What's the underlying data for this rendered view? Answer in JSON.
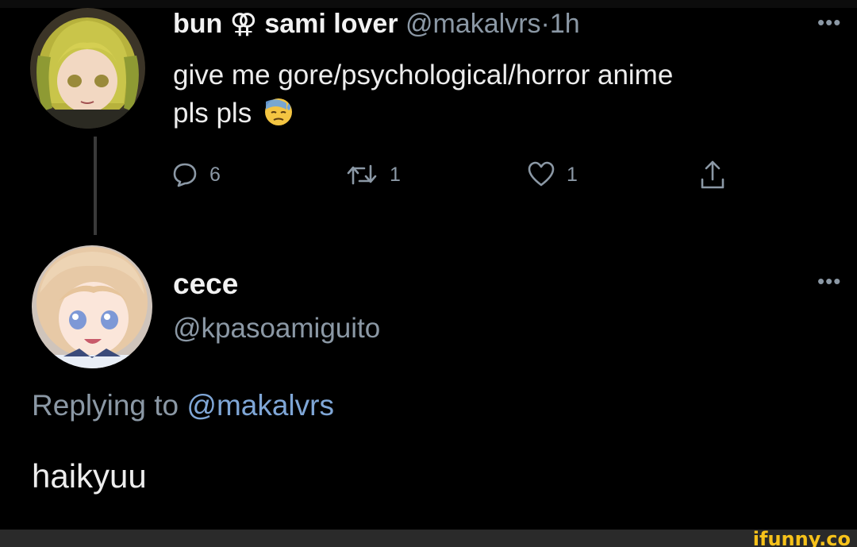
{
  "tweet": {
    "display_name": "bun ⚢ sami lover",
    "handle": "@makalvrs",
    "separator": "·",
    "time": "1h",
    "text_line1": "give me gore/psychological/horror anime",
    "text_line2": "pls pls",
    "emoji": "downcast-face-with-sweat-emoji",
    "more_label": "•••",
    "actions": {
      "reply_count": "6",
      "retweet_count": "1",
      "like_count": "1"
    },
    "icons": {
      "reply": "comment-icon",
      "retweet": "retweet-icon",
      "like": "heart-icon",
      "share": "share-icon"
    }
  },
  "reply": {
    "display_name": "cece",
    "handle": "@kpasoamiguito",
    "replying_prefix": "Replying to",
    "replying_mention": "@makalvrs",
    "text": "haikyuu",
    "more_label": "•••"
  },
  "watermark": "ifunny.co",
  "colors": {
    "background": "#000000",
    "text": "#e7e9ea",
    "secondary": "#8b98a5",
    "mention": "#7fa6d6",
    "watermark": "#f7c21a",
    "footer": "#2a2a2a"
  }
}
